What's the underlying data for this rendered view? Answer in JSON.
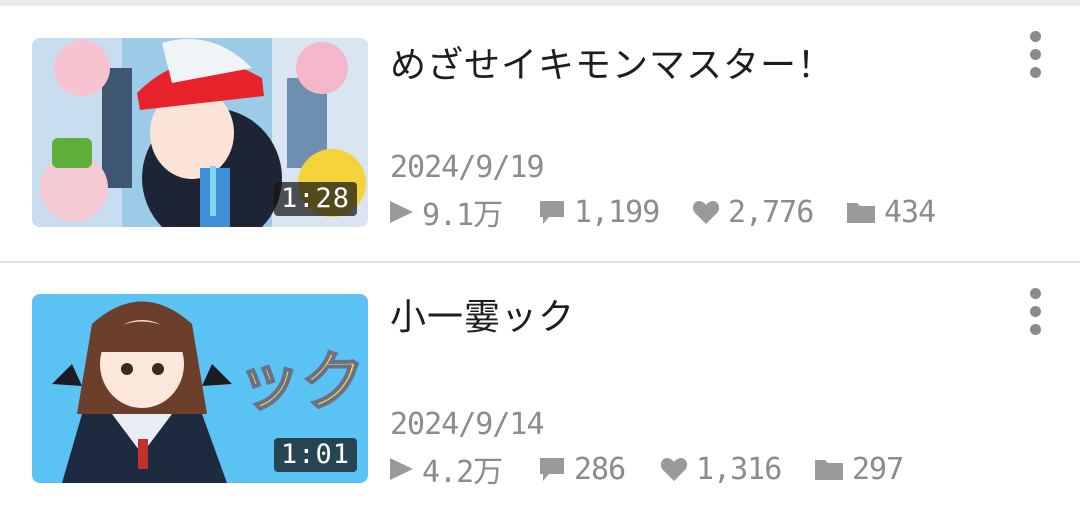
{
  "videos": [
    {
      "title": "めざせイキモンマスター！",
      "duration": "1:28",
      "date": "2024/9/19",
      "views": "9.1万",
      "comments": "1,199",
      "likes": "2,776",
      "saves": "434"
    },
    {
      "title": "小一霎ック",
      "duration": "1:01",
      "date": "2024/9/14",
      "views": "4.2万",
      "comments": "286",
      "likes": "1,316",
      "saves": "297"
    }
  ],
  "icons": {
    "views": "play-icon",
    "comments": "comment-icon",
    "likes": "heart-icon",
    "saves": "folder-icon",
    "menu": "more-vertical-icon"
  },
  "colors": {
    "meta_text": "#8c8c8c",
    "icon": "#9a9a9a",
    "duration_bg": "#141414",
    "thumb1_bg": "#9ccbe8",
    "thumb2_bg": "#5bc3f3"
  }
}
